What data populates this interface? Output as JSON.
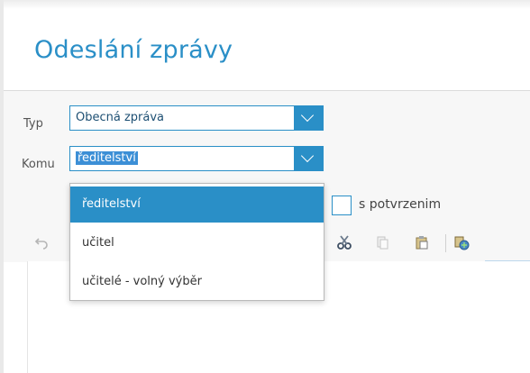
{
  "page": {
    "title": "Odeslání zprávy"
  },
  "form": {
    "type_label": "Typ",
    "type_value": "Obecná zpráva",
    "to_label": "Komu",
    "to_value": "ředitelství",
    "confirm_label": "s potvrzenim"
  },
  "dropdown": {
    "options": [
      "ředitelství",
      "učitel",
      "učitelé - volný výběr"
    ],
    "selected": "ředitelství"
  },
  "toolbar": {
    "icons": [
      "undo-icon",
      "cut-icon",
      "copy-icon",
      "paste-icon",
      "paste-special-icon"
    ]
  },
  "colors": {
    "accent": "#2a8fc7",
    "selection": "#3c8fd6"
  }
}
